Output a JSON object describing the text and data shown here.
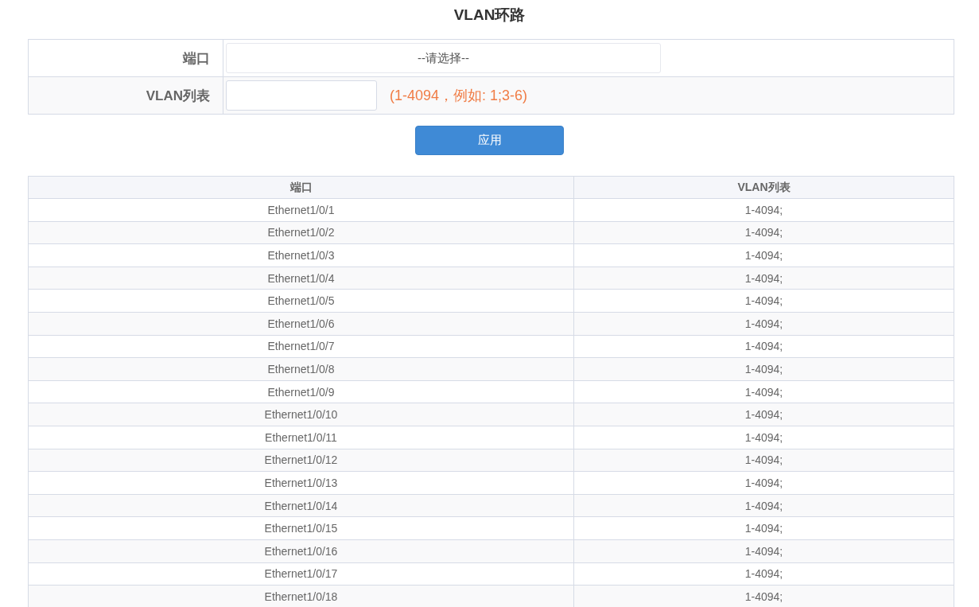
{
  "title": "VLAN环路",
  "form": {
    "port": {
      "label": "端口",
      "value": "--请选择--"
    },
    "vlan_list": {
      "label": "VLAN列表",
      "hint": "(1-4094，例如: 1;3-6)"
    }
  },
  "apply_button": "应用",
  "table": {
    "columns": [
      "端口",
      "VLAN列表"
    ],
    "rows": [
      [
        "Ethernet1/0/1",
        "1-4094;"
      ],
      [
        "Ethernet1/0/2",
        "1-4094;"
      ],
      [
        "Ethernet1/0/3",
        "1-4094;"
      ],
      [
        "Ethernet1/0/4",
        "1-4094;"
      ],
      [
        "Ethernet1/0/5",
        "1-4094;"
      ],
      [
        "Ethernet1/0/6",
        "1-4094;"
      ],
      [
        "Ethernet1/0/7",
        "1-4094;"
      ],
      [
        "Ethernet1/0/8",
        "1-4094;"
      ],
      [
        "Ethernet1/0/9",
        "1-4094;"
      ],
      [
        "Ethernet1/0/10",
        "1-4094;"
      ],
      [
        "Ethernet1/0/11",
        "1-4094;"
      ],
      [
        "Ethernet1/0/12",
        "1-4094;"
      ],
      [
        "Ethernet1/0/13",
        "1-4094;"
      ],
      [
        "Ethernet1/0/14",
        "1-4094;"
      ],
      [
        "Ethernet1/0/15",
        "1-4094;"
      ],
      [
        "Ethernet1/0/16",
        "1-4094;"
      ],
      [
        "Ethernet1/0/17",
        "1-4094;"
      ],
      [
        "Ethernet1/0/18",
        "1-4094;"
      ]
    ]
  }
}
